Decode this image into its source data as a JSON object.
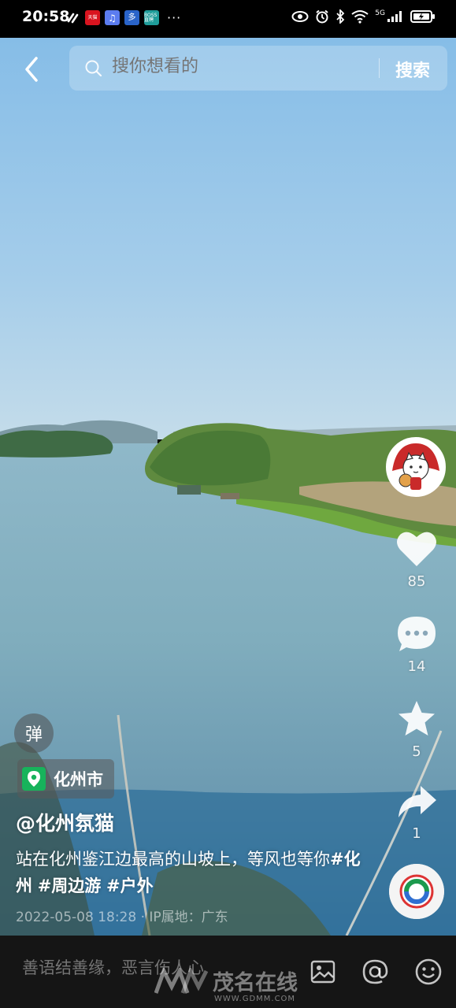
{
  "status_bar": {
    "time": "20:58",
    "app_badges": [
      "天猫",
      "♫",
      "多",
      "BOSS直聘"
    ],
    "overflow": "···",
    "network": "5G"
  },
  "search": {
    "placeholder": "搜你想看的",
    "button_label": "搜索"
  },
  "actions": {
    "likes": "85",
    "comments": "14",
    "favorites": "5",
    "shares": "1"
  },
  "danmu_label": "弹",
  "location": "化州市",
  "author": "@化州氛猫",
  "description": {
    "text": "站在化州鉴江边最高的山坡上，等风也等你",
    "tags": [
      "#化州",
      "#周边游",
      "#户外"
    ]
  },
  "meta": "2022-05-08 18:28 · IP属地：广东",
  "comment_bar": {
    "placeholder": "善语结善缘，恶言伤人心"
  },
  "watermark": {
    "text": "茂名在线",
    "url": "WWW.GDMM.COM"
  },
  "colors": {
    "location_green": "#17b35b",
    "bar_bg": "#151515"
  }
}
